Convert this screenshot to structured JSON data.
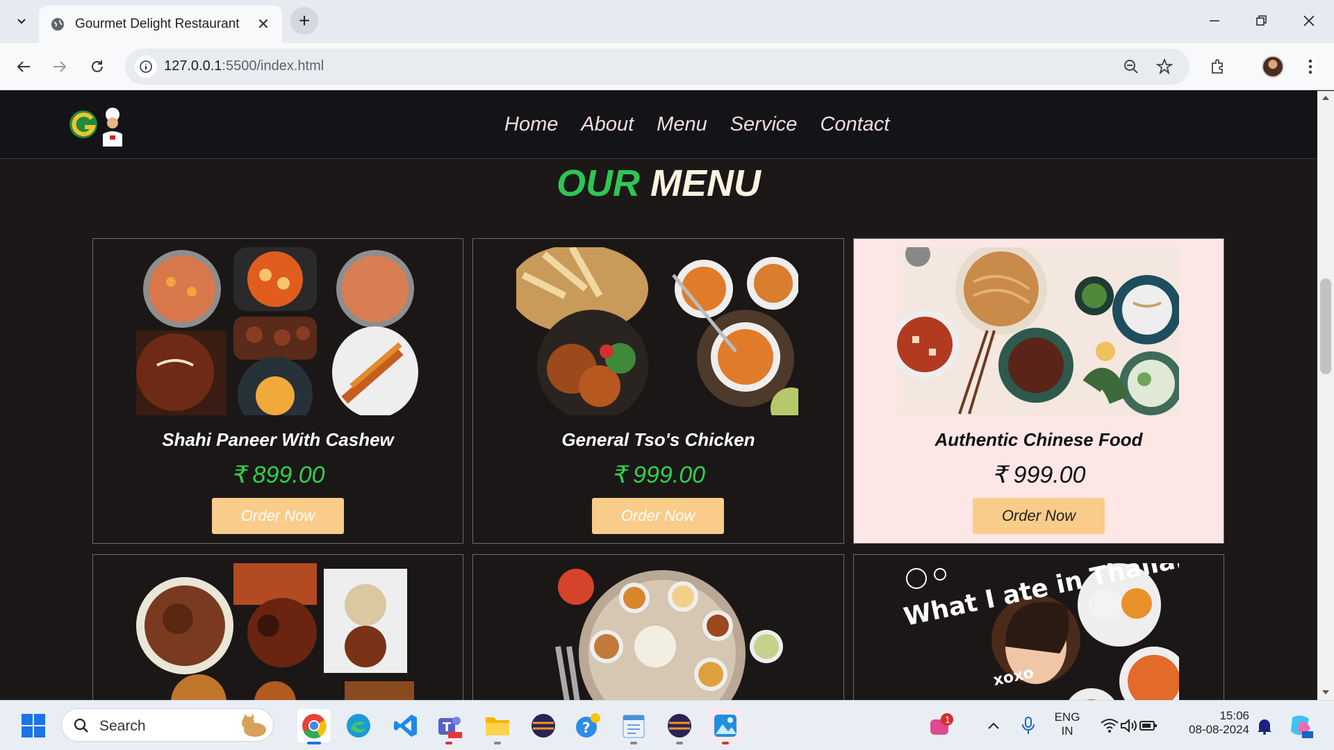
{
  "browser": {
    "tab_title": "Gourmet Delight Restaurant",
    "url_host": "127.0.0.1",
    "url_rest": ":5500/index.html"
  },
  "site": {
    "nav": [
      "Home",
      "About",
      "Menu",
      "Service",
      "Contact"
    ],
    "menu_title_green": "OUR",
    "menu_title_rest": " MENU"
  },
  "cards": [
    {
      "name": "Shahi Paneer With Cashew",
      "price": "₹ 899.00",
      "button": "Order Now"
    },
    {
      "name": "General Tso's Chicken",
      "price": "₹ 999.00",
      "button": "Order Now"
    },
    {
      "name": "Authentic Chinese Food",
      "price": "₹ 999.00",
      "button": "Order Now"
    },
    {
      "overlay_text": "What I ate in Thailand",
      "overlay_sign": "xoxo"
    }
  ],
  "taskbar": {
    "search_label": "Search",
    "lang1": "ENG",
    "lang2": "IN",
    "time": "15:06",
    "date": "08-08-2024",
    "notif_count": "1"
  },
  "colors": {
    "accent_green": "#2dc653",
    "button": "#f9cc8a",
    "highlight_card": "#fde6e6"
  }
}
